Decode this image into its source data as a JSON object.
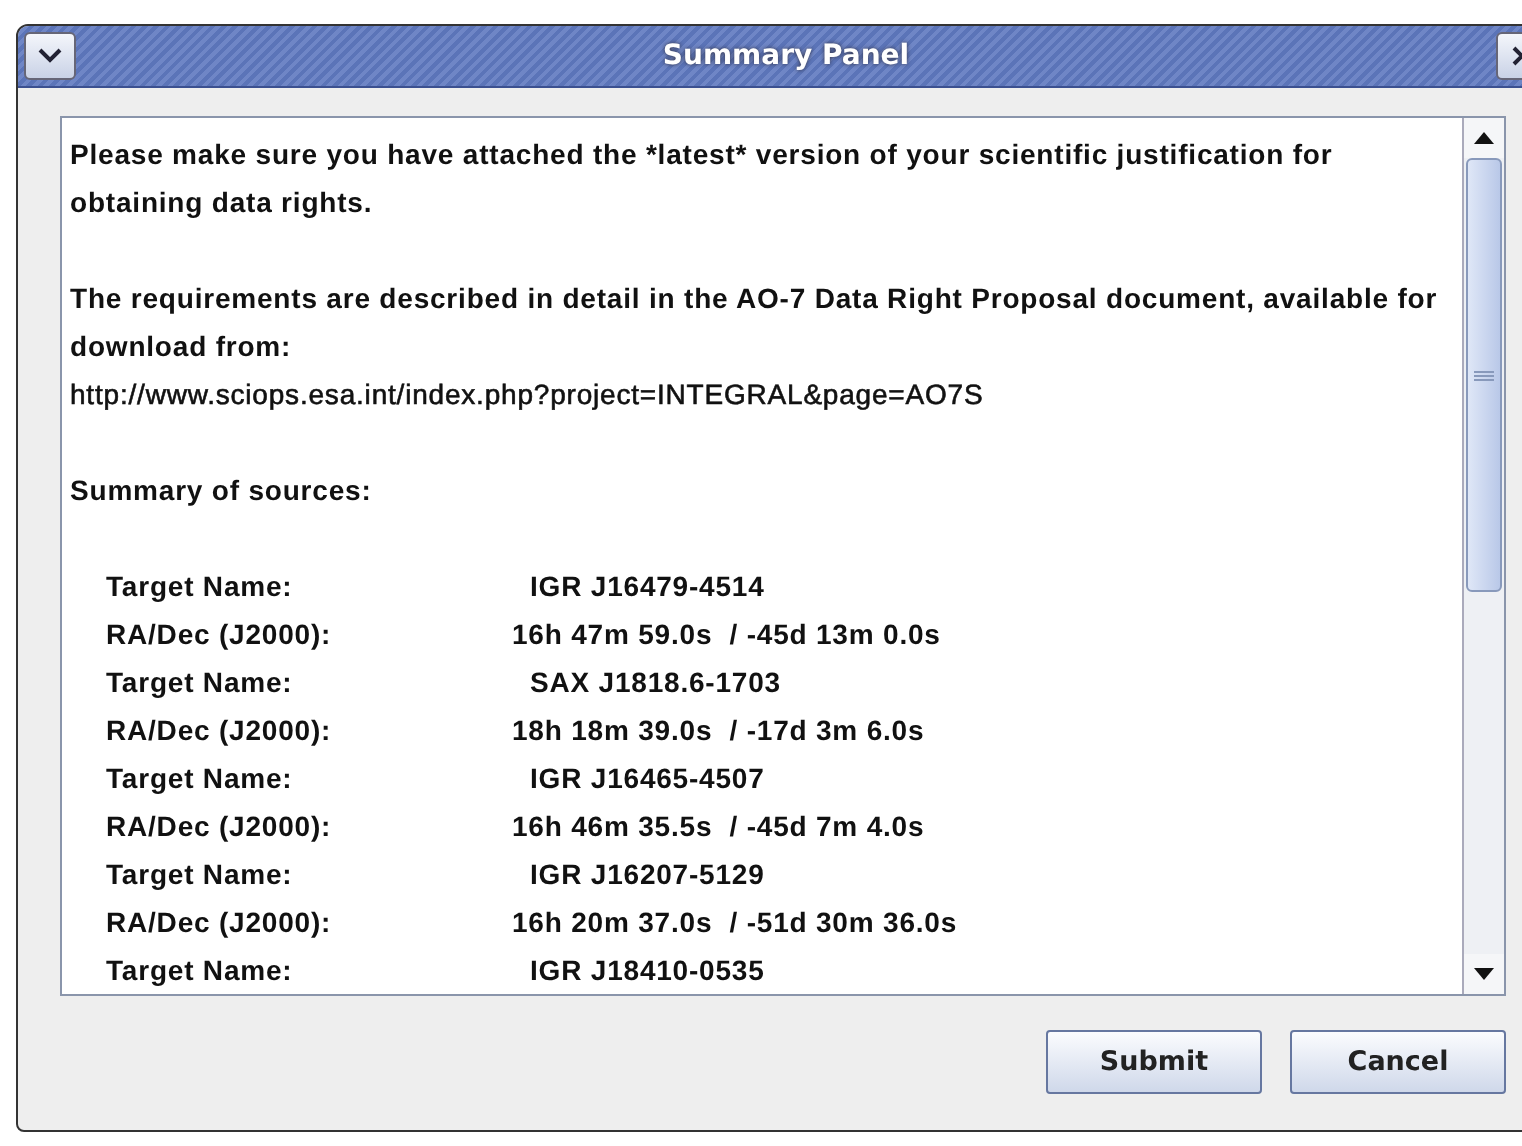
{
  "window": {
    "title": "Summary Panel"
  },
  "message": {
    "paragraphs": [
      "Please make sure you have attached the *latest* version of your scientific justification for obtaining data rights.",
      "The requirements are described in detail in the AO-7 Data Right Proposal document, available for download from:"
    ],
    "url": "http://www.sciops.esa.int/index.php?project=INTEGRAL&page=AO7S",
    "summary_heading": "Summary of sources:",
    "rows": [
      {
        "kind": "target",
        "label": "Target Name:",
        "value": "IGR J16479-4514"
      },
      {
        "kind": "coords",
        "label": "RA/Dec (J2000):",
        "value": "16h 47m 59.0s  / -45d 13m 0.0s"
      },
      {
        "kind": "target",
        "label": "Target Name:",
        "value": "SAX J1818.6-1703"
      },
      {
        "kind": "coords",
        "label": "RA/Dec (J2000):",
        "value": "18h 18m 39.0s  / -17d 3m 6.0s"
      },
      {
        "kind": "target",
        "label": "Target Name:",
        "value": "IGR J16465-4507"
      },
      {
        "kind": "coords",
        "label": "RA/Dec (J2000):",
        "value": "16h 46m 35.5s  / -45d 7m 4.0s"
      },
      {
        "kind": "target",
        "label": "Target Name:",
        "value": "IGR J16207-5129"
      },
      {
        "kind": "coords",
        "label": "RA/Dec (J2000):",
        "value": "16h 20m 37.0s  / -51d 30m 36.0s"
      },
      {
        "kind": "target",
        "label": "Target Name:",
        "value": "IGR J18410-0535"
      }
    ]
  },
  "buttons": [
    "Submit",
    "Cancel"
  ]
}
